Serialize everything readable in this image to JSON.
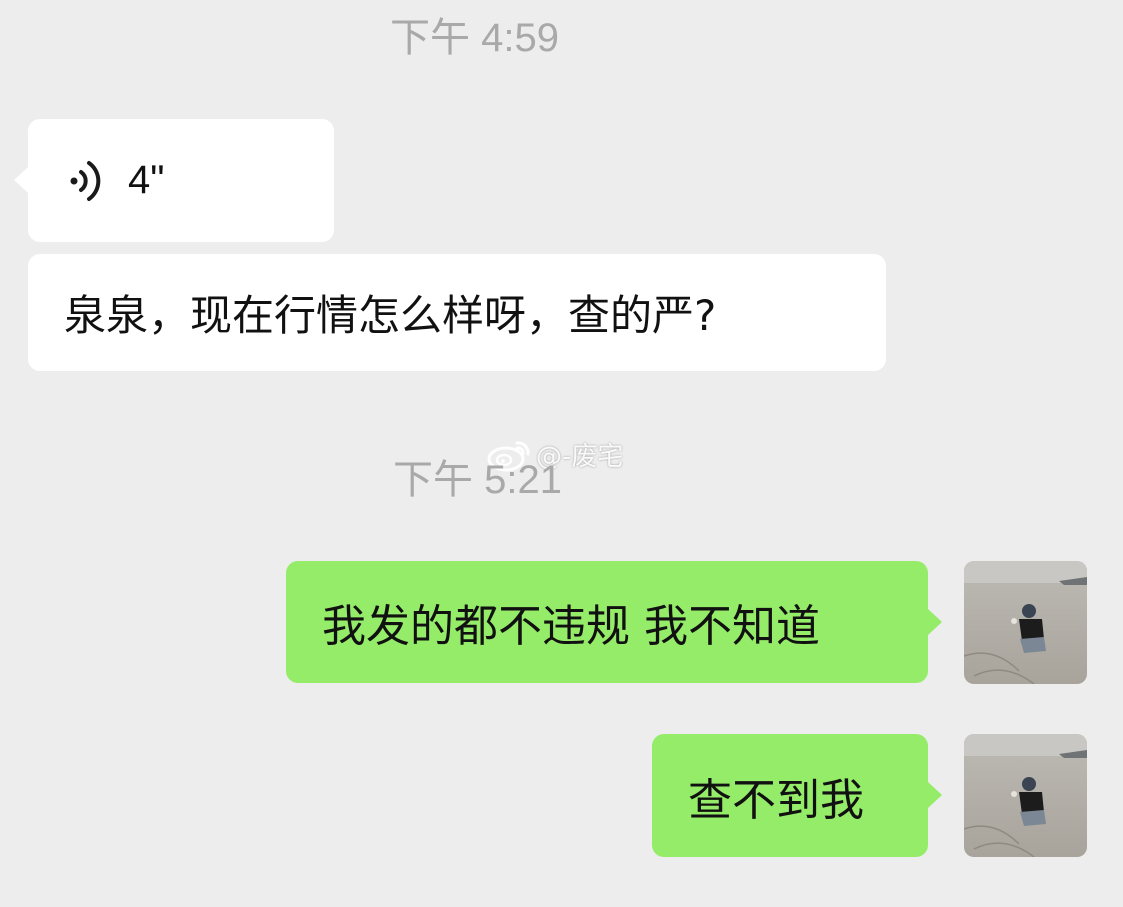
{
  "timestamps": [
    "下午 4:59",
    "下午 5:21"
  ],
  "messages": {
    "incoming_voice": {
      "icon": "voice-waves-icon",
      "duration": "4\""
    },
    "incoming_text": "泉泉，现在行情怎么样呀，查的严?",
    "outgoing": [
      "我发的都不违规 我不知道",
      "查不到我"
    ]
  },
  "watermark": {
    "icon": "weibo-icon",
    "text": "@-废宅"
  },
  "colors": {
    "background": "#ededed",
    "incoming_bubble": "#ffffff",
    "outgoing_bubble": "#95ec69",
    "timestamp": "#a9a9a9"
  }
}
